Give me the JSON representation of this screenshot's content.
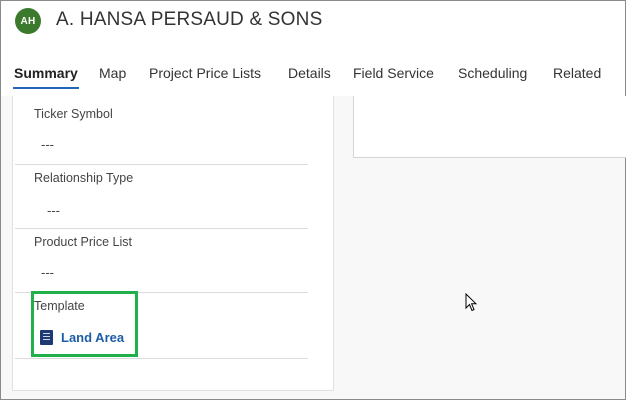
{
  "record": {
    "avatar_initials": "AH",
    "title": "A. HANSA PERSAUD & SONS"
  },
  "tabs": [
    {
      "label": "Summary"
    },
    {
      "label": "Map"
    },
    {
      "label": "Project Price Lists"
    },
    {
      "label": "Details"
    },
    {
      "label": "Field Service"
    },
    {
      "label": "Scheduling"
    },
    {
      "label": "Related"
    }
  ],
  "fields": [
    {
      "label": "Ticker Symbol",
      "value": "---"
    },
    {
      "label": "Relationship Type",
      "value": "---"
    },
    {
      "label": "Product Price List",
      "value": "---"
    },
    {
      "label": "Template",
      "value": "Land Area"
    }
  ],
  "colors": {
    "accent": "#2266b8",
    "highlight": "#21b04b",
    "avatar": "#3b7a2d",
    "link": "#1d5ca8"
  }
}
